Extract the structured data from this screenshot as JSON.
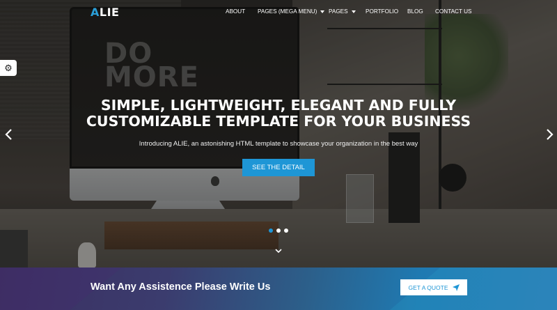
{
  "brand": {
    "logo_first": "A",
    "logo_rest": "LIE"
  },
  "nav": {
    "items": [
      {
        "label": "ABOUT"
      },
      {
        "label": "PAGES (MEGA MENU)",
        "has_dropdown": true
      },
      {
        "label": "PAGES",
        "has_dropdown": true
      },
      {
        "label": "PORTFOLIO"
      },
      {
        "label": "BLOG"
      },
      {
        "label": "CONTACT US"
      }
    ]
  },
  "settings": {
    "icon": "gear-icon"
  },
  "hero": {
    "screen_text": "DO\nMORE",
    "title_line1": "SIMPLE, LIGHTWEIGHT, ELEGANT AND FULLY",
    "title_line2": "CUSTOMIZABLE TEMPLATE FOR YOUR BUSINESS",
    "subtitle": "Introducing ALIE, an astonishing HTML template to showcase your organization in the best way",
    "cta_label": "SEE THE DETAIL",
    "slides_count": 3,
    "active_slide": 1,
    "prev_icon": "chevron-left-icon",
    "next_icon": "chevron-right-icon",
    "scroll_icon": "chevron-down-icon"
  },
  "banner": {
    "text": "Want Any Assistence Please Write Us",
    "button_label": "GET A QUOTE",
    "button_icon": "paper-plane-icon"
  },
  "colors": {
    "accent": "#1e96d6",
    "banner_start": "#3b2f61",
    "banner_end": "#2e7bb6"
  }
}
